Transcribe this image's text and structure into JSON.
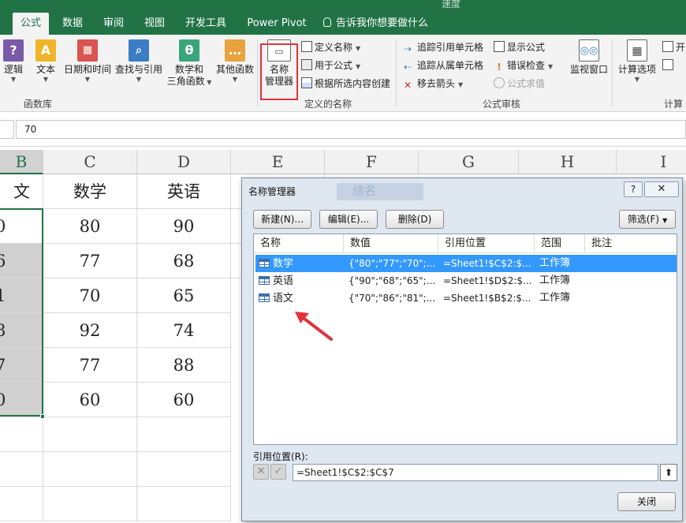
{
  "window": {
    "title_fragment": "速度"
  },
  "tabs": [
    {
      "label": "公式",
      "active": true
    },
    {
      "label": "数据"
    },
    {
      "label": "审阅"
    },
    {
      "label": "视图"
    },
    {
      "label": "开发工具"
    },
    {
      "label": "Power Pivot"
    }
  ],
  "tell_me": "告诉我你想要做什么",
  "ribbon": {
    "function_library": {
      "label": "函数库",
      "buttons": [
        "逻辑",
        "文本",
        "日期和时间",
        "查找与引用",
        "数学和",
        "三角函数",
        "其他函数"
      ]
    },
    "defined_names": {
      "label": "定义的名称",
      "name_manager": [
        "名称",
        "管理器"
      ],
      "define_name": "定义名称",
      "use_in_formula": "用于公式",
      "create_from_selection": "根据所选内容创建"
    },
    "formula_auditing": {
      "label": "公式审核",
      "trace_precedents": "追踪引用单元格",
      "trace_dependents": "追踪从属单元格",
      "remove_arrows": "移去箭头",
      "show_formulas": "显示公式",
      "error_checking": "错误检查",
      "evaluate_formula": "公式求值",
      "watch_window": "监视窗口"
    },
    "calculation": {
      "label": "计算",
      "calc_options": "计算选项",
      "calc_now_fragment": "开"
    }
  },
  "formula_bar": {
    "value": "70"
  },
  "sheet": {
    "columns": [
      "B",
      "C",
      "D",
      "E",
      "F",
      "G",
      "H",
      "I"
    ],
    "header_row": [
      "文",
      "数学",
      "英语"
    ],
    "rows": [
      [
        "0",
        "80",
        "90"
      ],
      [
        "6",
        "77",
        "68"
      ],
      [
        "1",
        "70",
        "65"
      ],
      [
        "8",
        "92",
        "74"
      ],
      [
        "7",
        "77",
        "88"
      ],
      [
        "0",
        "60",
        "60"
      ]
    ],
    "ghost_text": "绩名"
  },
  "dialog": {
    "title": "名称管理器",
    "help": "?",
    "close": "✕",
    "new_button": "新建(N)...",
    "edit_button": "编辑(E)...",
    "delete_button": "删除(D)",
    "filter_button": "筛选(F)",
    "columns": [
      "名称",
      "数值",
      "引用位置",
      "范围",
      "批注"
    ],
    "names": [
      {
        "name": "数学",
        "value": "{\"80\";\"77\";\"70\";...",
        "refers_to": "=Sheet1!$C$2:$...",
        "scope": "工作簿",
        "comment": "",
        "selected": true
      },
      {
        "name": "英语",
        "value": "{\"90\";\"68\";\"65\";...",
        "refers_to": "=Sheet1!$D$2:$...",
        "scope": "工作簿",
        "comment": ""
      },
      {
        "name": "语文",
        "value": "{\"70\";\"86\";\"81\";...",
        "refers_to": "=Sheet1!$B$2:$...",
        "scope": "工作簿",
        "comment": ""
      }
    ],
    "refers_to_label": "引用位置(R):",
    "refers_to_value": "=Sheet1!$C$2:$C$7",
    "close_button": "关闭"
  },
  "colors": {
    "excel_green": "#217346",
    "highlight_red": "#e0333a",
    "selection_blue": "#3399ff"
  }
}
